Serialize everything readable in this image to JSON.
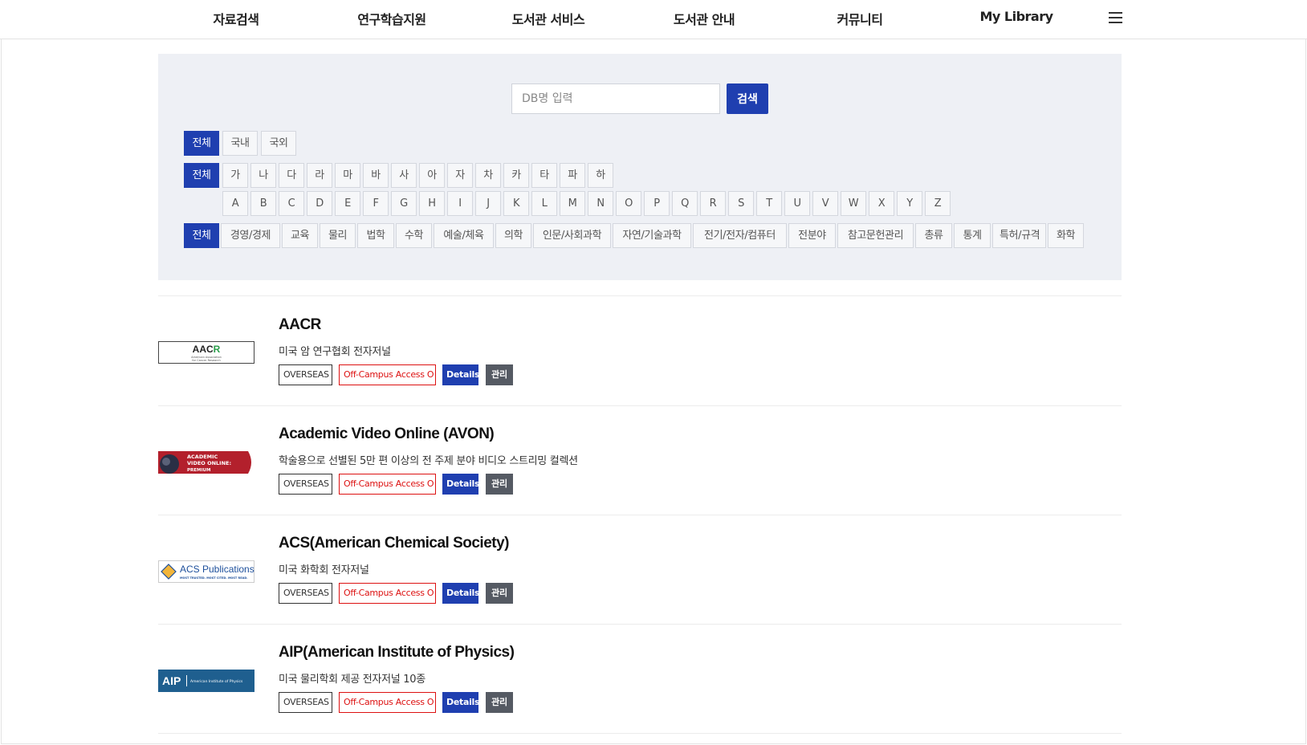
{
  "nav": {
    "items": [
      "자료검색",
      "연구학습지원",
      "도서관 서비스",
      "도서관 안내",
      "커뮤니티",
      "My Library"
    ]
  },
  "search": {
    "placeholder": "DB명 입력",
    "button": "검색"
  },
  "filters": {
    "region": [
      "전체",
      "국내",
      "국외"
    ],
    "korean_initials": [
      "전체",
      "가",
      "나",
      "다",
      "라",
      "마",
      "바",
      "사",
      "아",
      "자",
      "차",
      "카",
      "타",
      "파",
      "하"
    ],
    "alphabet": [
      "A",
      "B",
      "C",
      "D",
      "E",
      "F",
      "G",
      "H",
      "I",
      "J",
      "K",
      "L",
      "M",
      "N",
      "O",
      "P",
      "Q",
      "R",
      "S",
      "T",
      "U",
      "V",
      "W",
      "X",
      "Y",
      "Z"
    ],
    "subjects": [
      "전체",
      "경영/경제",
      "교육",
      "물리",
      "법학",
      "수학",
      "예술/체육",
      "의학",
      "인문/사회과학",
      "자연/기술과학",
      "전기/전자/컴퓨터",
      "전분야",
      "참고문헌관리",
      "총류",
      "통계",
      "특허/규격",
      "화학"
    ]
  },
  "colors": {
    "accent": "#1f3fb0",
    "offcampus": "#dd1111",
    "manage": "#555a63"
  },
  "databases": [
    {
      "title": "AACR",
      "desc": "미국 암 연구협회 전자저널",
      "logo_text": "AACR",
      "logo_sub": "American Association for Cancer Research",
      "tags": {
        "overseas": "OVERSEAS",
        "offcampus": "Off-Campus Access O",
        "details": "Details",
        "manage": "관리"
      }
    },
    {
      "title": "Academic Video Online (AVON)",
      "desc": "학술용으로 선별된 5만 편 이상의 전 주제 분야 비디오 스트리밍 컬렉션",
      "logo_text": "ACADEMIC VIDEO ONLINE: PREMIUM",
      "tags": {
        "overseas": "OVERSEAS",
        "offcampus": "Off-Campus Access O",
        "details": "Details",
        "manage": "관리"
      }
    },
    {
      "title": "ACS(American Chemical Society)",
      "desc": "미국 화학회 전자저널",
      "logo_text": "ACS Publications",
      "logo_sub": "MOST TRUSTED. MOST CITED. MOST READ.",
      "tags": {
        "overseas": "OVERSEAS",
        "offcampus": "Off-Campus Access O",
        "details": "Details",
        "manage": "관리"
      }
    },
    {
      "title": "AIP(American Institute of Physics)",
      "desc": "미국 물리학회 제공 전자저널 10종",
      "logo_text": "AIP",
      "logo_sub": "American Institute of Physics",
      "tags": {
        "overseas": "OVERSEAS",
        "offcampus": "Off-Campus Access O",
        "details": "Details",
        "manage": "관리"
      }
    }
  ]
}
